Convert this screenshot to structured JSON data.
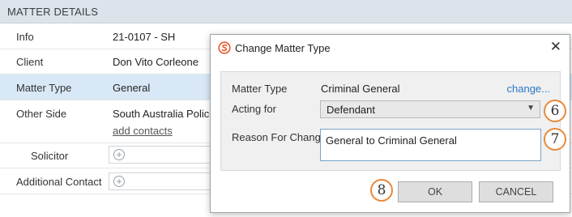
{
  "matter_details": {
    "header": "MATTER DETAILS",
    "rows": [
      {
        "label": "Info",
        "value": "21-0107 - SH"
      },
      {
        "label": "Client",
        "value": "Don Vito Corleone"
      },
      {
        "label": "Matter Type",
        "value": "General"
      },
      {
        "label": "Other Side",
        "value": "South Australia Police",
        "link": "add contacts"
      },
      {
        "label": "Solicitor",
        "value": ""
      },
      {
        "label": "Additional Contact",
        "value": ""
      }
    ],
    "add_icon": "+"
  },
  "dialog": {
    "title": "Change Matter Type",
    "close_icon": "✕",
    "matter_type_label": "Matter Type",
    "matter_type_value": "Criminal General",
    "change_link": "change...",
    "acting_for_label": "Acting for",
    "acting_for_value": "Defendant",
    "reason_label": "Reason For Change",
    "reason_value": "General to Criminal General",
    "ok_label": "OK",
    "cancel_label": "CANCEL"
  },
  "annotations": {
    "badge_6": "6",
    "badge_7": "7",
    "badge_8": "8",
    "color": "#e8893a"
  },
  "colors": {
    "selected_row": "#d9e8f7",
    "link": "#2b78c5",
    "logo": "#e8572a"
  }
}
